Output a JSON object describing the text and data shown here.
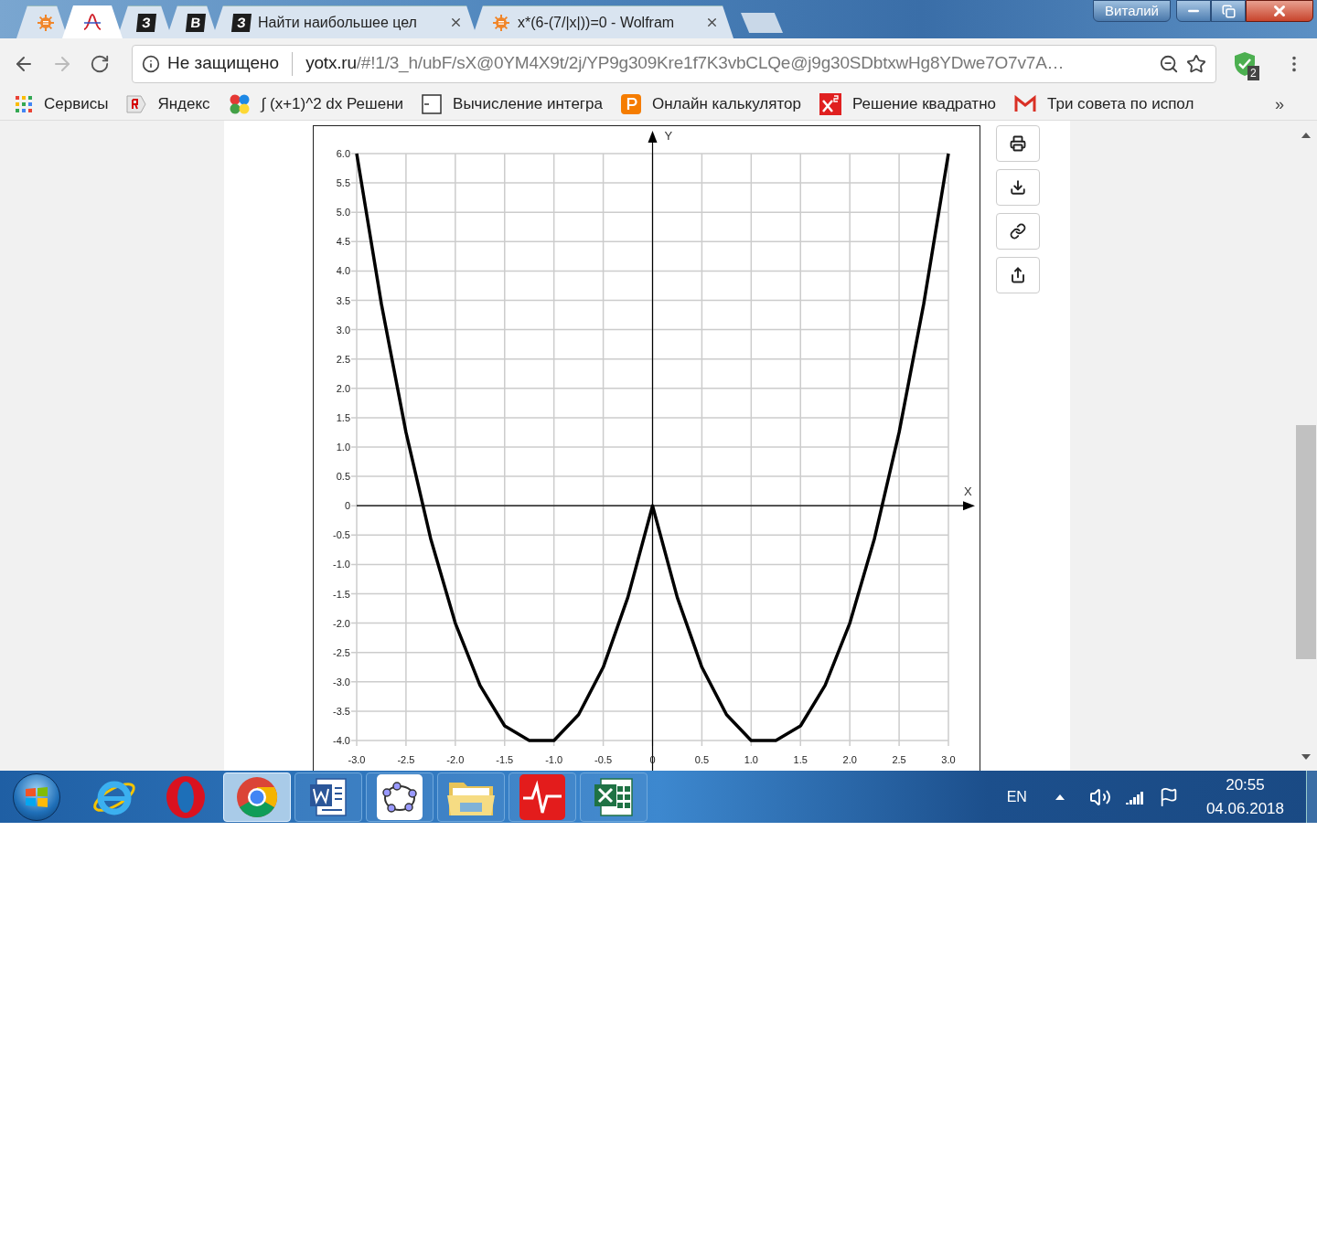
{
  "window": {
    "profile": "Виталий"
  },
  "tabs": [
    {
      "selected": false
    },
    {
      "selected": true
    },
    {
      "letter": "З",
      "selected": false
    },
    {
      "letter": "В",
      "selected": false
    },
    {
      "letter": "З",
      "title": "Найти наибольшее цел",
      "selected": false
    },
    {
      "title": "x*(6-(7/|x|))=0 - Wolfram",
      "selected": false
    }
  ],
  "toolbar": {
    "security": "Не защищено",
    "url_host": "yotx.ru",
    "url_rest": "/#!1/3_h/ubF/sX@0YM4X9t/2j/YP9g309Kre1f7K3vbCLQe@j9g30SDbtxwHg8YDwe7O7v7A…",
    "extension_badge": "2"
  },
  "bookmarks": [
    {
      "label": "Сервисы"
    },
    {
      "label": "Яндекс"
    },
    {
      "label": "∫ (x+1)^2 dx Решени"
    },
    {
      "label": "Вычисление интегра"
    },
    {
      "label": "Онлайн калькулятор"
    },
    {
      "label": "Решение квадратно"
    },
    {
      "label": "Три совета по испол"
    }
  ],
  "bookmarks_more": "»",
  "graph": {
    "chart_data": {
      "type": "line",
      "xlabel": "X",
      "ylabel": "Y",
      "grid": true,
      "x": [
        -3,
        -2.75,
        -2.5,
        -2.25,
        -2,
        -1.75,
        -1.5,
        -1.25,
        -1,
        -0.75,
        -0.5,
        -0.25,
        0,
        0.25,
        0.5,
        0.75,
        1,
        1.25,
        1.5,
        1.75,
        2,
        2.25,
        2.5,
        2.75,
        3
      ],
      "series": [
        {
          "color": "#000000",
          "values": [
            6,
            3.44,
            1.25,
            -0.56,
            -2,
            -3.06,
            -3.75,
            -4,
            -4,
            -3.56,
            -2.75,
            -1.56,
            0,
            -1.56,
            -2.75,
            -3.56,
            -4,
            -4,
            -3.75,
            -3.06,
            -2,
            -0.56,
            1.25,
            3.44,
            6
          ]
        }
      ],
      "xlim": [
        -3,
        3
      ],
      "ylim": [
        -4,
        6
      ],
      "xticks": [
        {
          "value": -3,
          "label": "-3.0"
        },
        {
          "value": -2.5,
          "label": "-2.5"
        },
        {
          "value": -2,
          "label": "-2.0"
        },
        {
          "value": -1.5,
          "label": "-1.5"
        },
        {
          "value": -1,
          "label": "-1.0"
        },
        {
          "value": -0.5,
          "label": "-0.5"
        },
        {
          "value": 0,
          "label": "0"
        },
        {
          "value": 0.5,
          "label": "0.5"
        },
        {
          "value": 1,
          "label": "1.0"
        },
        {
          "value": 1.5,
          "label": "1.5"
        },
        {
          "value": 2,
          "label": "2.0"
        },
        {
          "value": 2.5,
          "label": "2.5"
        },
        {
          "value": 3,
          "label": "3.0"
        }
      ],
      "yticks": [
        {
          "value": 6,
          "label": "6.0"
        },
        {
          "value": 5.5,
          "label": "5.5"
        },
        {
          "value": 5,
          "label": "5.0"
        },
        {
          "value": 4.5,
          "label": "4.5"
        },
        {
          "value": 4,
          "label": "4.0"
        },
        {
          "value": 3.5,
          "label": "3.5"
        },
        {
          "value": 3,
          "label": "3.0"
        },
        {
          "value": 2.5,
          "label": "2.5"
        },
        {
          "value": 2,
          "label": "2.0"
        },
        {
          "value": 1.5,
          "label": "1.5"
        },
        {
          "value": 1,
          "label": "1.0"
        },
        {
          "value": 0.5,
          "label": "0.5"
        },
        {
          "value": 0,
          "label": "0"
        },
        {
          "value": -0.5,
          "label": "-0.5"
        },
        {
          "value": -1,
          "label": "-1.0"
        },
        {
          "value": -1.5,
          "label": "-1.5"
        },
        {
          "value": -2,
          "label": "-2.0"
        },
        {
          "value": -2.5,
          "label": "-2.5"
        },
        {
          "value": -3,
          "label": "-3.0"
        },
        {
          "value": -3.5,
          "label": "-3.5"
        },
        {
          "value": -4,
          "label": "-4.0"
        }
      ]
    }
  },
  "taskbar": {
    "apps": [
      {
        "selected": false
      },
      {
        "selected": false
      },
      {
        "selected": true
      },
      {
        "selected": false
      },
      {
        "selected": false
      },
      {
        "selected": false
      },
      {
        "selected": false
      },
      {
        "selected": false
      }
    ],
    "tray": {
      "language": "EN",
      "time": "20:55",
      "date": "04.06.2018"
    }
  }
}
